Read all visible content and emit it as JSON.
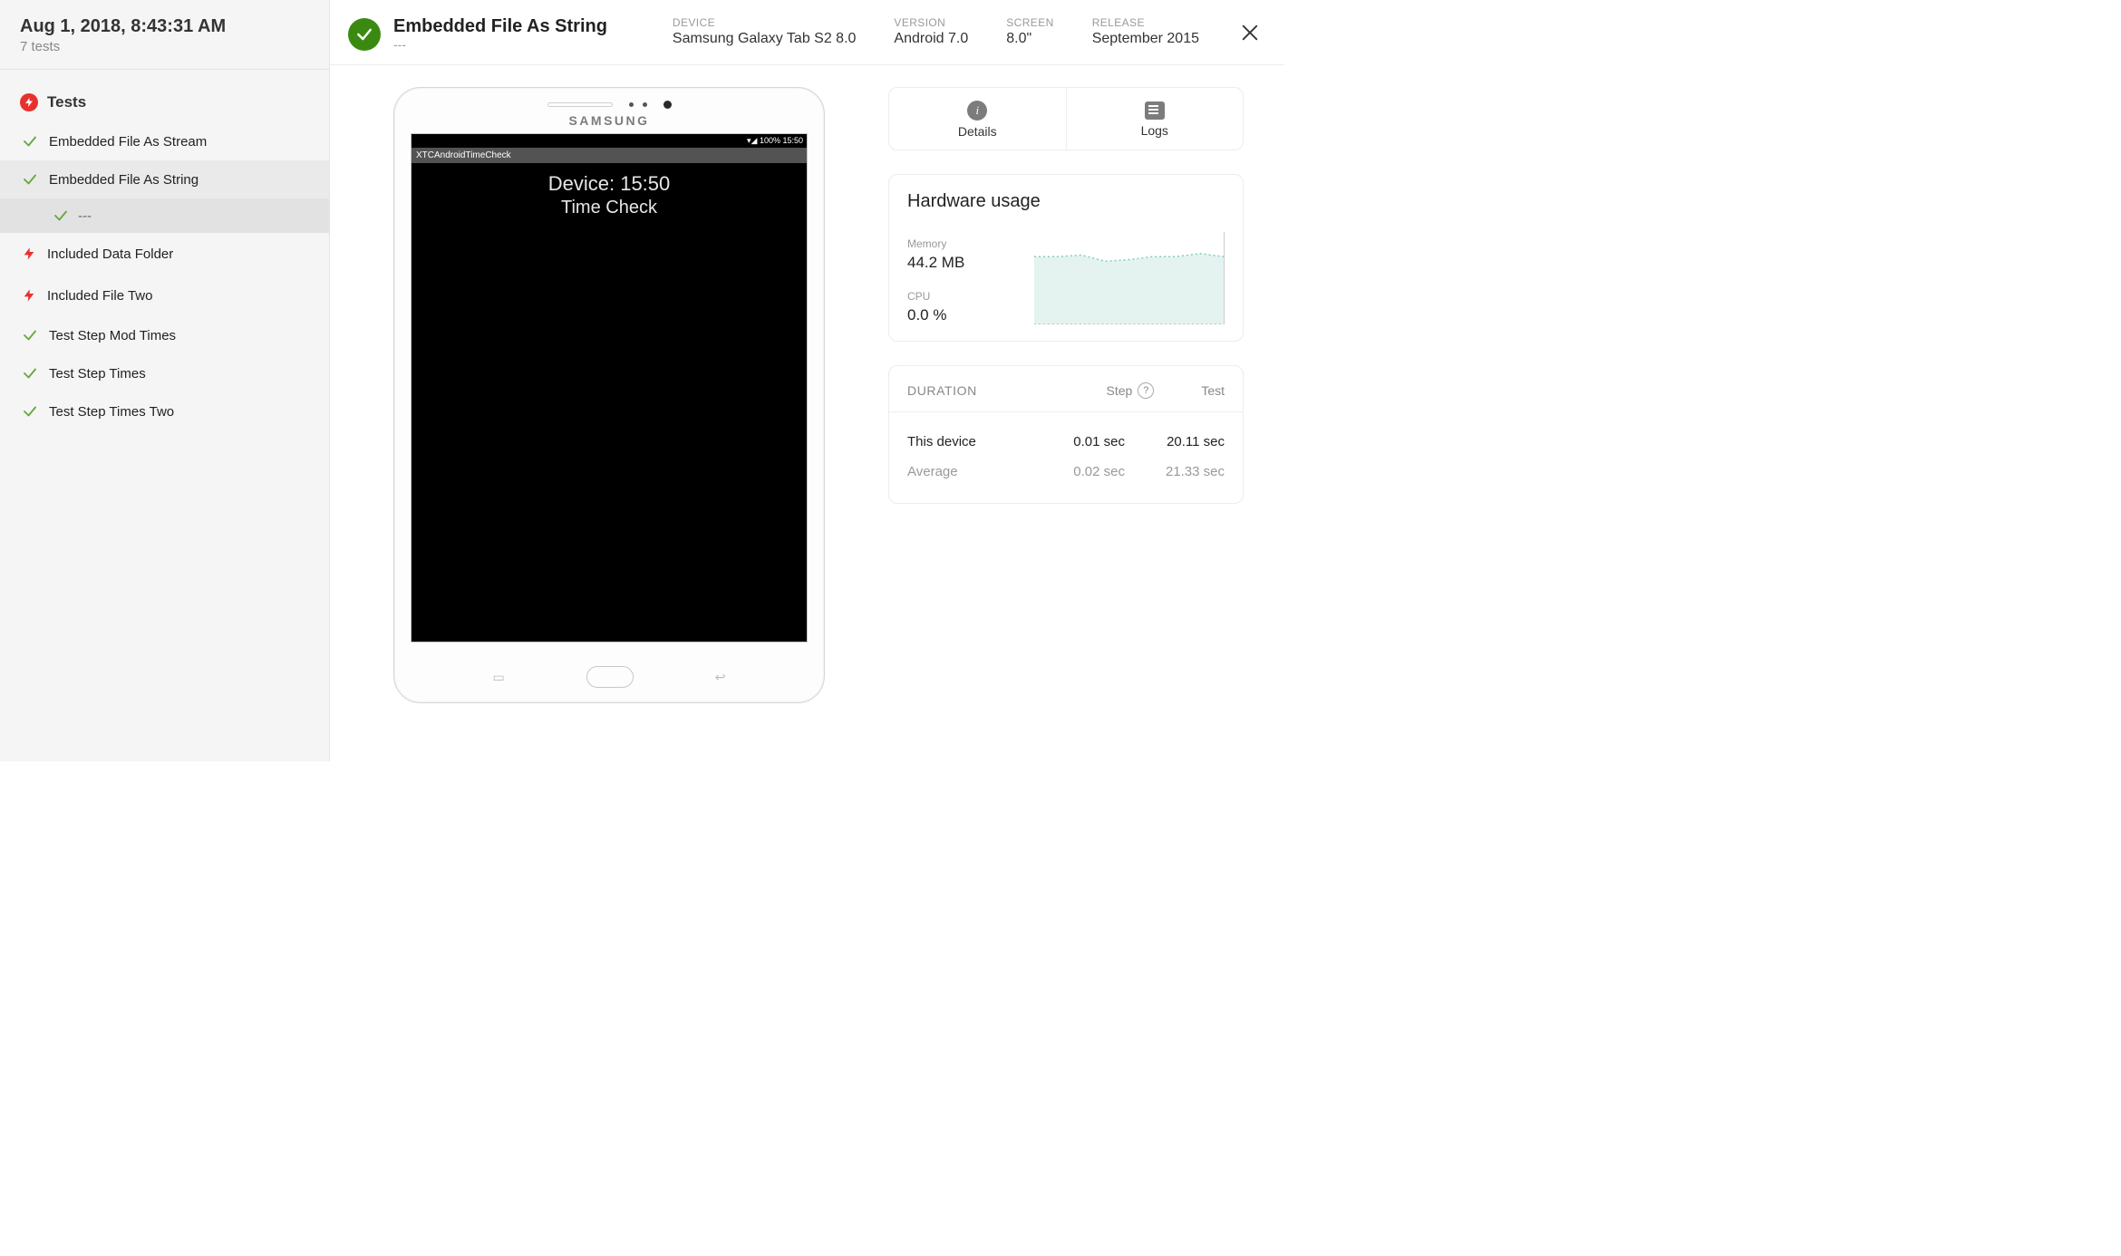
{
  "sidebar": {
    "date": "Aug 1, 2018, 8:43:31 AM",
    "subtitle": "7 tests",
    "header_label": "Tests",
    "tests": [
      {
        "label": "Embedded File As Stream",
        "status": "pass"
      },
      {
        "label": "Embedded File As String",
        "status": "pass",
        "active": true,
        "steps": [
          {
            "label": "---",
            "status": "pass"
          }
        ]
      },
      {
        "label": "Included Data Folder",
        "status": "fail"
      },
      {
        "label": "Included File Two",
        "status": "fail"
      },
      {
        "label": "Test Step Mod Times",
        "status": "pass"
      },
      {
        "label": "Test Step Times",
        "status": "pass"
      },
      {
        "label": "Test Step Times Two",
        "status": "pass"
      }
    ]
  },
  "header": {
    "title": "Embedded File As String",
    "subtitle": "---",
    "meta": [
      {
        "label": "DEVICE",
        "value": "Samsung Galaxy Tab S2 8.0"
      },
      {
        "label": "VERSION",
        "value": "Android 7.0"
      },
      {
        "label": "SCREEN",
        "value": "8.0\""
      },
      {
        "label": "RELEASE",
        "value": "September 2015"
      }
    ]
  },
  "device_screen": {
    "brand": "SAMSUNG",
    "status_text": "100%  15:50",
    "app_bar": "XTCAndroidTimeCheck",
    "line1": "Device: 15:50",
    "line2": "Time Check"
  },
  "tabs": {
    "details": "Details",
    "logs": "Logs"
  },
  "hardware": {
    "title": "Hardware usage",
    "memory_label": "Memory",
    "memory_value": "44.2 MB",
    "cpu_label": "CPU",
    "cpu_value": "0.0 %"
  },
  "duration": {
    "label": "DURATION",
    "step_label": "Step",
    "test_label": "Test",
    "rows": [
      {
        "name": "This device",
        "step": "0.01 sec",
        "test": "20.11 sec",
        "muted": false
      },
      {
        "name": "Average",
        "step": "0.02 sec",
        "test": "21.33 sec",
        "muted": true
      }
    ]
  },
  "chart_data": {
    "type": "area",
    "series": [
      {
        "name": "Memory",
        "values": [
          44,
          44,
          45,
          41,
          42,
          44,
          44,
          46,
          44
        ],
        "color": "#bfe8e4",
        "ylim": [
          0,
          60
        ]
      },
      {
        "name": "CPU",
        "values": [
          0,
          0,
          0,
          0,
          0,
          0,
          0,
          0,
          0
        ],
        "color": "#a6c96a",
        "ylim": [
          0,
          100
        ]
      }
    ],
    "x": [
      0,
      1,
      2,
      3,
      4,
      5,
      6,
      7,
      8
    ]
  }
}
